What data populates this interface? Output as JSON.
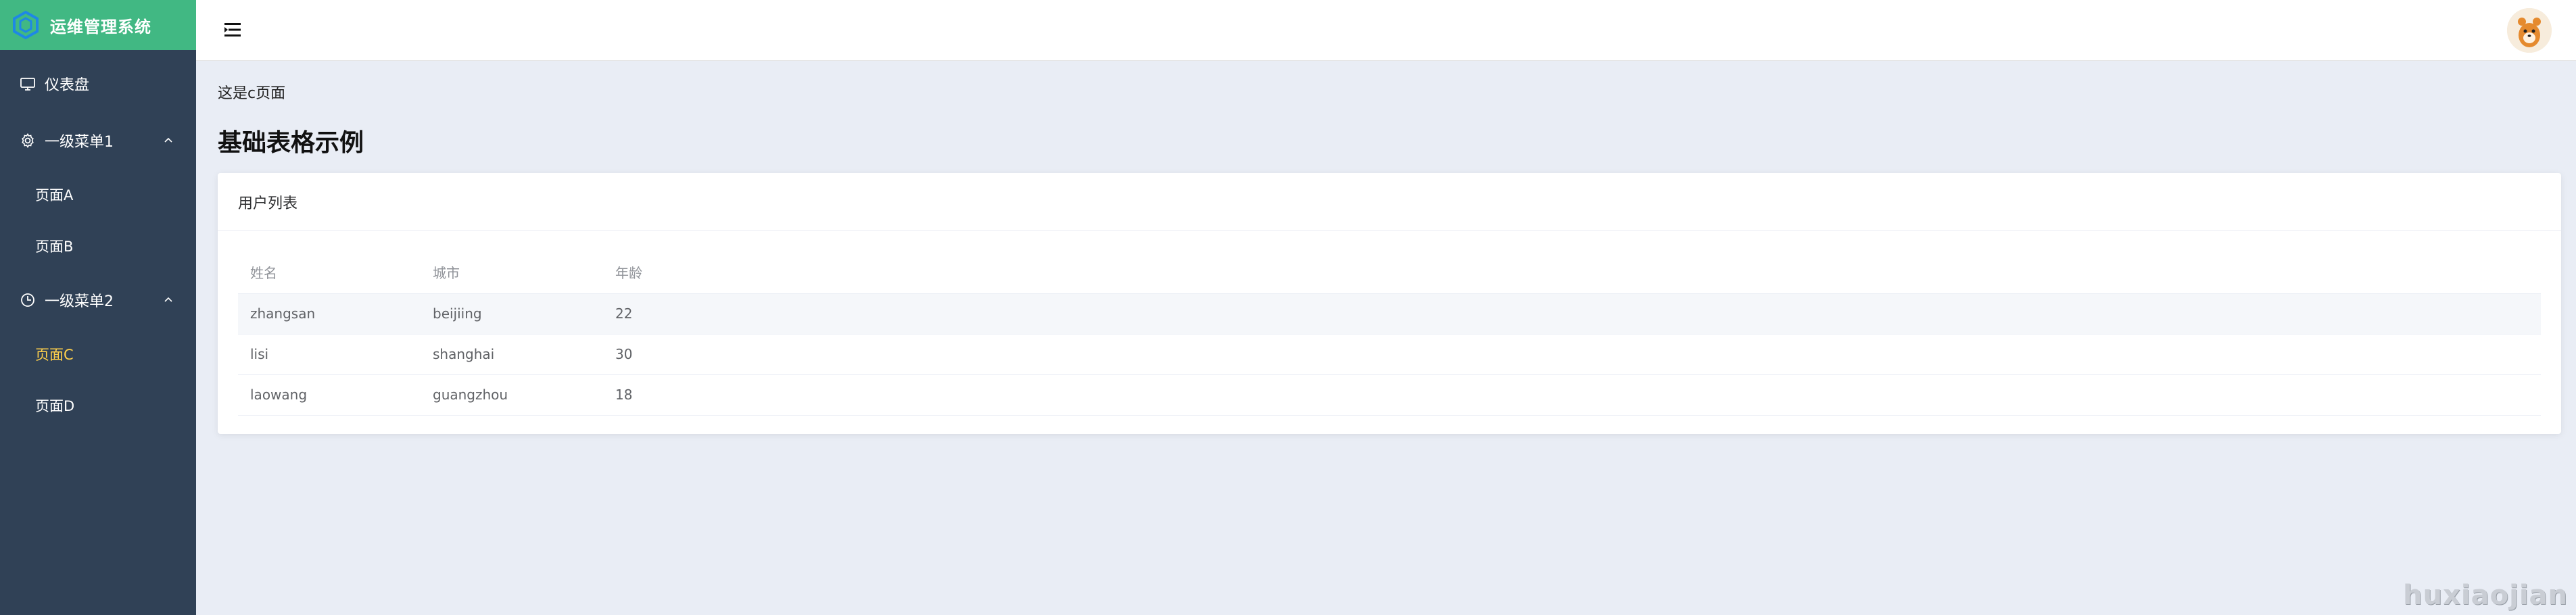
{
  "brand": {
    "title": "运维管理系统",
    "icon": "hexagon-logo-icon"
  },
  "sidebar": {
    "items": [
      {
        "label": "仪表盘",
        "icon": "monitor-icon"
      },
      {
        "label": "一级菜单1",
        "icon": "gear-icon",
        "expanded": true,
        "children": [
          {
            "label": "页面A"
          },
          {
            "label": "页面B"
          }
        ]
      },
      {
        "label": "一级菜单2",
        "icon": "clock-icon",
        "expanded": true,
        "children": [
          {
            "label": "页面C",
            "active": true
          },
          {
            "label": "页面D"
          }
        ]
      }
    ]
  },
  "header": {
    "menu_toggle_icon": "hamburger-icon",
    "avatar_icon": "avatar-icon"
  },
  "main": {
    "note": "这是c页面",
    "heading": "基础表格示例",
    "card": {
      "title": "用户列表",
      "columns": [
        "姓名",
        "城市",
        "年龄"
      ],
      "rows": [
        [
          "zhangsan",
          "beijiing",
          "22"
        ],
        [
          "lisi",
          "shanghai",
          "30"
        ],
        [
          "laowang",
          "guangzhou",
          "18"
        ]
      ]
    }
  },
  "watermark": "huxiaojian",
  "colors": {
    "sidebar_bg": "#304156",
    "brand_bg": "#41b883",
    "active_item": "#ffd04b",
    "page_bg": "#e9edf5"
  }
}
